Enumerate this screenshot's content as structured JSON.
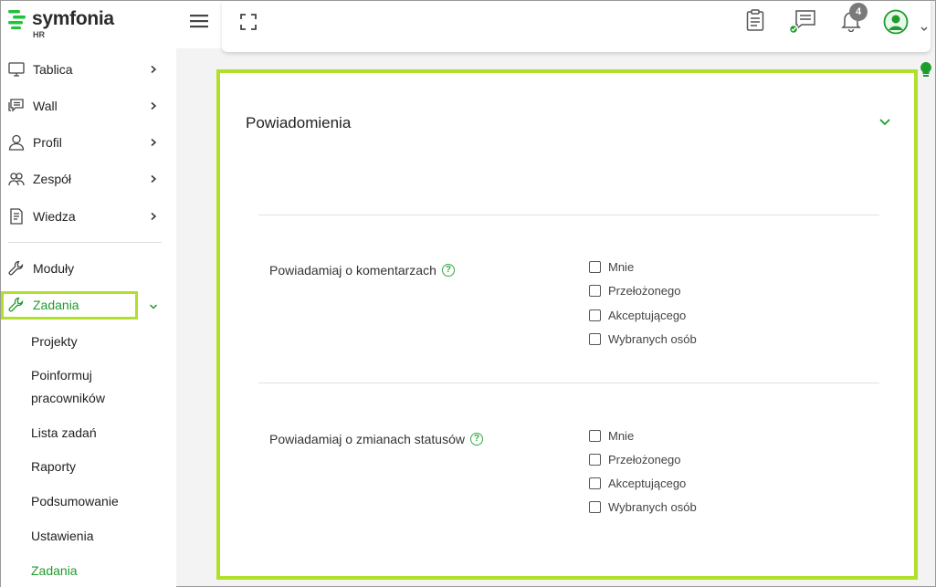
{
  "brand": {
    "name": "symfonia",
    "sub": "HR",
    "color": "#1e9c2c"
  },
  "sidebar": {
    "items": [
      {
        "label": "Tablica",
        "icon": "monitor-icon"
      },
      {
        "label": "Wall",
        "icon": "chat-icon"
      },
      {
        "label": "Profil",
        "icon": "user-icon"
      },
      {
        "label": "Zespół",
        "icon": "team-icon"
      },
      {
        "label": "Wiedza",
        "icon": "document-icon"
      }
    ],
    "modules_label": "Moduły",
    "active_label": "Zadania",
    "subitems": [
      "Projekty",
      "Poinformuj",
      "pracowników",
      "Lista zadań",
      "Raporty",
      "Podsumowanie",
      "Ustawienia",
      "Zadania"
    ]
  },
  "header": {
    "notification_count": "4",
    "accent": "#b0e02b"
  },
  "panel": {
    "title": "Powiadomienia",
    "sections": [
      {
        "label": "Powiadamiaj o komentarzach",
        "options": [
          "Mnie",
          "Przełożonego",
          "Akceptującego",
          "Wybranych osób"
        ]
      },
      {
        "label": "Powiadamiaj o zmianach statusów",
        "options": [
          "Mnie",
          "Przełożonego",
          "Akceptującego",
          "Wybranych osób"
        ]
      }
    ],
    "help": "?"
  }
}
